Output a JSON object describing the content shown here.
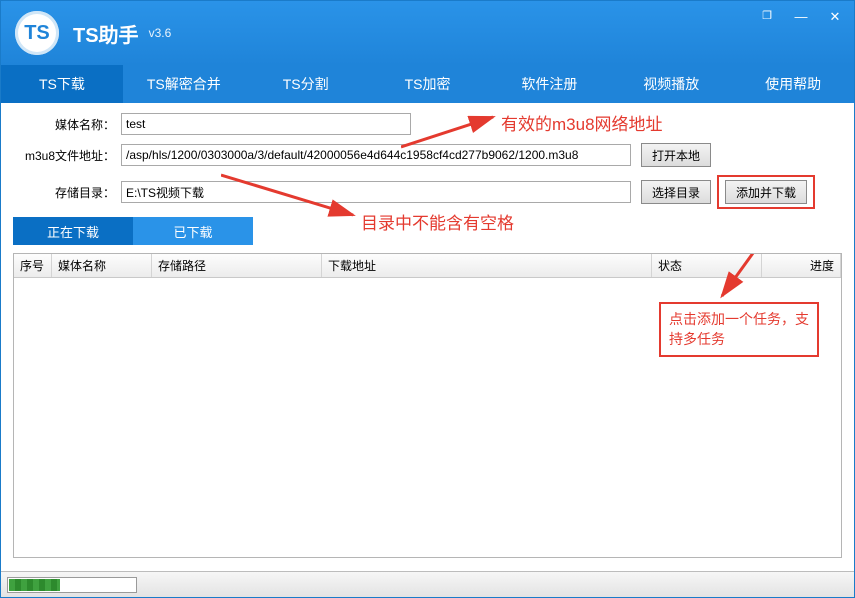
{
  "window": {
    "logo_text": "TS",
    "title": "TS助手",
    "version": "v3.6",
    "min_icon": "—",
    "restore_icon": "❐",
    "close_icon": "✕"
  },
  "main_tabs": [
    "TS下载",
    "TS解密合并",
    "TS分割",
    "TS加密",
    "软件注册",
    "视频播放",
    "使用帮助"
  ],
  "form": {
    "media_label": "媒体名称：",
    "media_value": "test",
    "m3u8_label": "m3u8文件地址：",
    "m3u8_value": "/asp/hls/1200/0303000a/3/default/42000056e4d644c1958cf4cd277b9062/1200.m3u8",
    "open_local_btn": "打开本地",
    "storage_label": "存储目录：",
    "storage_value": "E:\\TS视频下载",
    "choose_dir_btn": "选择目录",
    "add_download_btn": "添加并下载"
  },
  "sub_tabs": {
    "downloading": "正在下载",
    "downloaded": "已下载"
  },
  "annotations": {
    "valid_m3u8": "有效的m3u8网络地址",
    "no_spaces": "目录中不能含有空格",
    "click_add": "点击添加一个任务，支持多任务"
  },
  "table": {
    "columns": [
      "序号",
      "媒体名称",
      "存储路径",
      "下载地址",
      "状态",
      "进度"
    ],
    "rows": []
  }
}
